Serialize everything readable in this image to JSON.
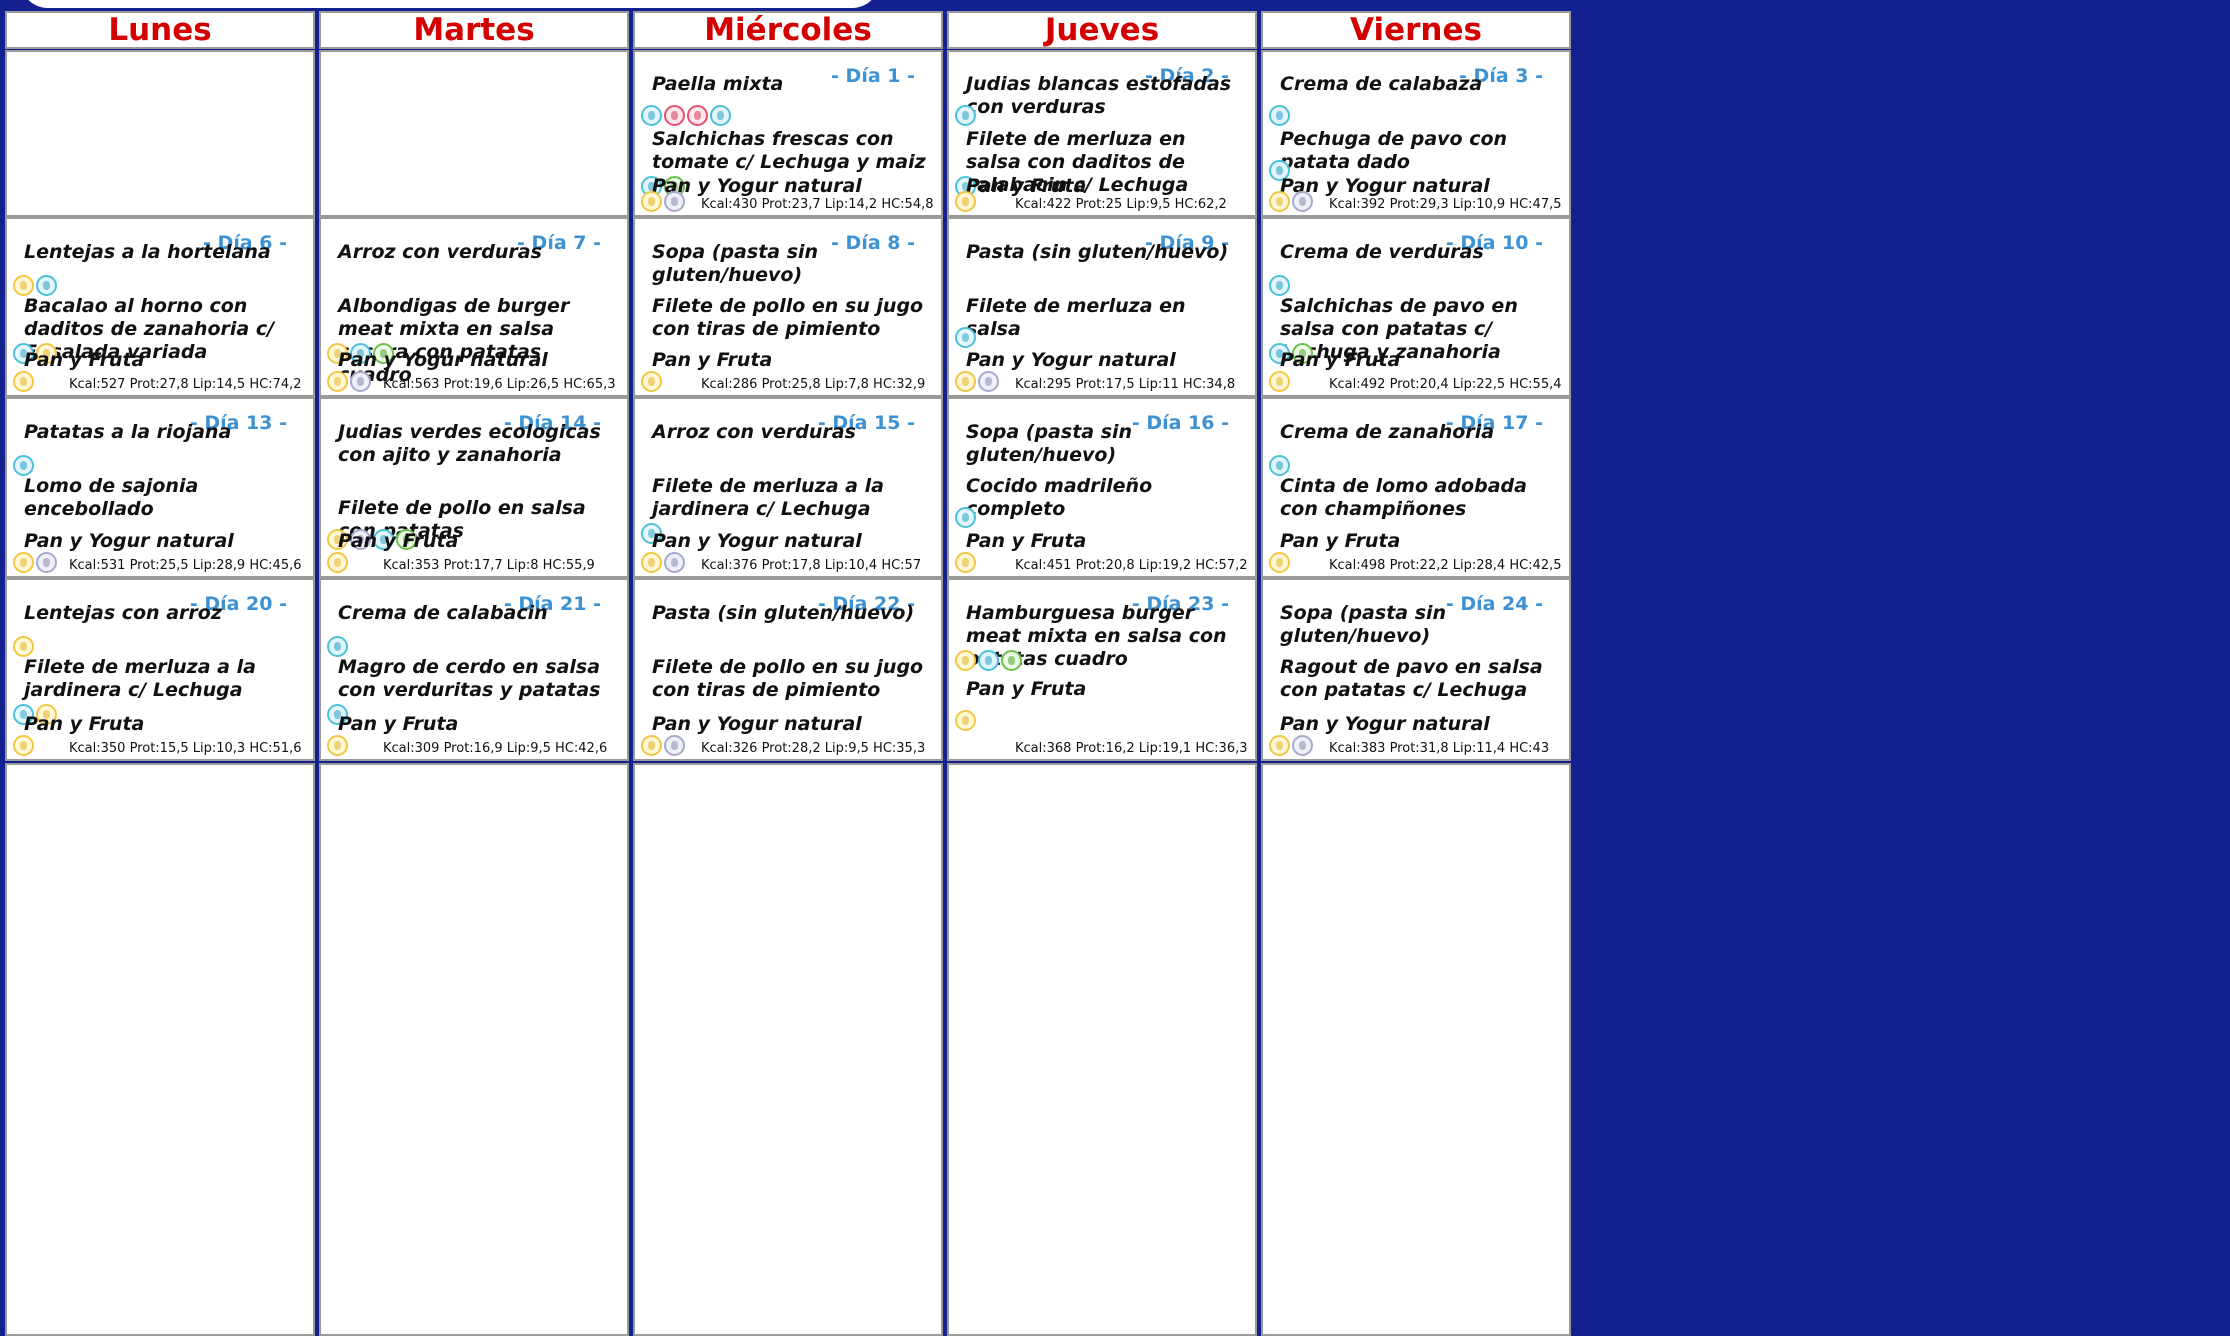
{
  "headers": [
    "Lunes",
    "Martes",
    "Miércoles",
    "Jueves",
    "Viernes"
  ],
  "weeks": [
    [
      null,
      null,
      {
        "day": "- Día 1 -",
        "first": "Paella mixta",
        "first_icons": [
          "egg",
          "mustard",
          "mustard",
          "egg"
        ],
        "second": "Salchichas frescas con tomate c/ Lechuga y maiz",
        "second_icons": [
          "egg",
          "celery"
        ],
        "dessert": "Pan y Yogur natural",
        "dessert_icons": [
          "gluten",
          "milk"
        ],
        "nutrition": "Kcal:430 Prot:23,7 Lip:14,2 HC:54,8"
      },
      {
        "day": "- Día 2 -",
        "first": "Judias blancas estofadas con verduras",
        "first_icons": [
          "egg"
        ],
        "second": "Filete de merluza en salsa con daditos de calabacin c/ Lechuga",
        "second_icons": [
          "fish"
        ],
        "dessert": "Pan y Fruta",
        "dessert_icons": [
          "gluten"
        ],
        "nutrition": "Kcal:422 Prot:25 Lip:9,5 HC:62,2"
      },
      {
        "day": "- Día 3 -",
        "first": "Crema de calabaza",
        "first_icons": [
          "egg"
        ],
        "second": "Pechuga de pavo con patata dado",
        "second_icons": [
          "egg"
        ],
        "dessert": "Pan y Yogur natural",
        "dessert_icons": [
          "gluten",
          "milk"
        ],
        "nutrition": "Kcal:392 Prot:29,3 Lip:10,9 HC:47,5"
      }
    ],
    [
      {
        "day": "- Día 6 -",
        "first": "Lentejas a la hortelana",
        "first_icons": [
          "gluten",
          "egg"
        ],
        "second": "Bacalao al horno con daditos de zanahoria c/ Ensalada variada",
        "second_icons": [
          "fish",
          "gluten"
        ],
        "dessert": "Pan y Fruta",
        "dessert_icons": [
          "gluten"
        ],
        "nutrition": "Kcal:527 Prot:27,8 Lip:14,5 HC:74,2"
      },
      {
        "day": "- Día 7 -",
        "first": "Arroz con verduras",
        "first_icons": [],
        "second": "Albondigas de burger meat mixta en salsa casera con patatas cuadro",
        "second_icons": [
          "gluten",
          "egg",
          "celery"
        ],
        "dessert": "Pan y Yogur natural",
        "dessert_icons": [
          "gluten",
          "milk"
        ],
        "nutrition": "Kcal:563 Prot:19,6 Lip:26,5 HC:65,3"
      },
      {
        "day": "- Día 8 -",
        "first": "Sopa (pasta sin gluten/huevo)",
        "first_icons": [],
        "second": "Filete de pollo en su jugo con tiras de pimiento",
        "second_icons": [],
        "dessert": "Pan y Fruta",
        "dessert_icons": [
          "gluten"
        ],
        "nutrition": "Kcal:286 Prot:25,8 Lip:7,8 HC:32,9"
      },
      {
        "day": "- Día 9 -",
        "first": "Pasta (sin gluten/huevo)",
        "first_icons": [],
        "second": "Filete de merluza en salsa",
        "second_icons": [
          "fish"
        ],
        "dessert": "Pan y Yogur natural",
        "dessert_icons": [
          "gluten",
          "milk"
        ],
        "nutrition": "Kcal:295 Prot:17,5 Lip:11 HC:34,8"
      },
      {
        "day": "- Día 10 -",
        "first": "Crema de verduras",
        "first_icons": [
          "egg"
        ],
        "second": "Salchichas de pavo en salsa con patatas c/ Lechuga y zanahoria",
        "second_icons": [
          "egg",
          "celery"
        ],
        "dessert": "Pan y Fruta",
        "dessert_icons": [
          "gluten"
        ],
        "nutrition": "Kcal:492 Prot:20,4 Lip:22,5 HC:55,4"
      }
    ],
    [
      {
        "day": "- Día 13 -",
        "first": "Patatas a la riojana",
        "first_icons": [
          "egg"
        ],
        "second": "Lomo de sajonia encebollado",
        "second_icons": [],
        "dessert": "Pan y Yogur natural",
        "dessert_icons": [
          "gluten",
          "milk"
        ],
        "nutrition": "Kcal:531 Prot:25,5 Lip:28,9 HC:45,6"
      },
      {
        "day": "- Día 14 -",
        "first": "Judias verdes ecologicas con ajito y zanahoria",
        "first_icons": [],
        "second": "Filete de pollo en salsa con patatas",
        "second_icons": [
          "gluten",
          "milk",
          "egg",
          "celery"
        ],
        "dessert": "Pan y Fruta",
        "dessert_icons": [
          "gluten"
        ],
        "nutrition": "Kcal:353 Prot:17,7 Lip:8 HC:55,9"
      },
      {
        "day": "- Día 15 -",
        "first": "Arroz con verduras",
        "first_icons": [],
        "second": "Filete de merluza a la jardinera c/ Lechuga",
        "second_icons": [
          "fish"
        ],
        "dessert": "Pan y Yogur natural",
        "dessert_icons": [
          "gluten",
          "milk"
        ],
        "nutrition": "Kcal:376 Prot:17,8 Lip:10,4 HC:57"
      },
      {
        "day": "- Día 16 -",
        "first": "Sopa (pasta sin gluten/huevo)",
        "first_icons": [],
        "second": "Cocido madrileño completo",
        "second_icons": [
          "egg"
        ],
        "dessert": "Pan y Fruta",
        "dessert_icons": [
          "gluten"
        ],
        "nutrition": "Kcal:451 Prot:20,8 Lip:19,2 HC:57,2"
      },
      {
        "day": "- Día 17 -",
        "first": "Crema de zanahoria",
        "first_icons": [
          "egg"
        ],
        "second": "Cinta de lomo adobada con champiñones",
        "second_icons": [],
        "dessert": "Pan y Fruta",
        "dessert_icons": [
          "gluten"
        ],
        "nutrition": "Kcal:498 Prot:22,2 Lip:28,4 HC:42,5"
      }
    ],
    [
      {
        "day": "- Día 20 -",
        "first": "Lentejas con arroz",
        "first_icons": [
          "gluten"
        ],
        "second": "Filete de merluza a la jardinera c/ Lechuga",
        "second_icons": [
          "fish",
          "gluten"
        ],
        "dessert": "Pan y Fruta",
        "dessert_icons": [
          "gluten"
        ],
        "nutrition": "Kcal:350 Prot:15,5 Lip:10,3 HC:51,6"
      },
      {
        "day": "- Día 21 -",
        "first": "Crema de calabacin",
        "first_icons": [
          "egg"
        ],
        "second": "Magro de cerdo en salsa con verduritas y patatas",
        "second_icons": [
          "egg"
        ],
        "dessert": "Pan y Fruta",
        "dessert_icons": [
          "gluten"
        ],
        "nutrition": "Kcal:309 Prot:16,9 Lip:9,5 HC:42,6"
      },
      {
        "day": "- Día 22 -",
        "first": "Pasta (sin gluten/huevo)",
        "first_icons": [],
        "second": "Filete de pollo en su jugo con tiras de pimiento",
        "second_icons": [],
        "dessert": "Pan y Yogur natural",
        "dessert_icons": [
          "gluten",
          "milk"
        ],
        "nutrition": "Kcal:326 Prot:28,2 Lip:9,5 HC:35,3"
      },
      {
        "day": "- Día 23 -",
        "first": "Hamburguesa burger meat mixta en salsa con patatas cuadro",
        "first_icons": [
          "gluten",
          "egg",
          "celery"
        ],
        "second": "Pan y Fruta",
        "second_icons": [
          "gluten"
        ],
        "dessert": "",
        "dessert_icons": [],
        "nutrition": "Kcal:368 Prot:16,2 Lip:19,1 HC:36,3"
      },
      {
        "day": "- Día 24 -",
        "first": "Sopa (pasta sin gluten/huevo)",
        "first_icons": [],
        "second": "Ragout de pavo en salsa con patatas c/ Lechuga",
        "second_icons": [],
        "dessert": "Pan y Yogur natural",
        "dessert_icons": [
          "gluten",
          "milk"
        ],
        "nutrition": "Kcal:383 Prot:31,8 Lip:11,4 HC:43"
      }
    ],
    [
      null,
      null,
      null,
      null,
      null
    ]
  ],
  "icon_names": {
    "gluten": "gluten-icon",
    "fish": "fish-icon",
    "milk": "milk-icon",
    "egg": "egg-icon",
    "celery": "celery-icon",
    "mustard": "mustard-icon"
  },
  "colors": {
    "background": "#14208f",
    "header_text": "#d40000",
    "day_label": "#3d92d3"
  }
}
